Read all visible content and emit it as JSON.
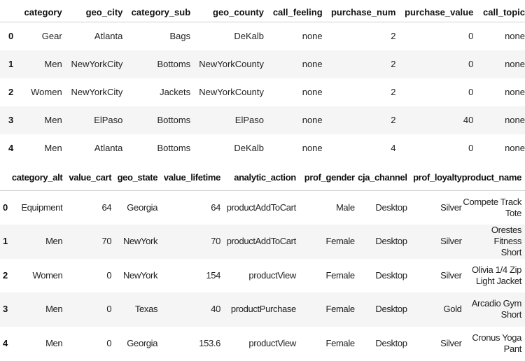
{
  "table1": {
    "columns": [
      "category",
      "geo_city",
      "category_sub",
      "geo_county",
      "call_feeling",
      "purchase_num",
      "purchase_value",
      "call_topic"
    ],
    "rows": [
      {
        "index": "0",
        "cells": [
          "Gear",
          "Atlanta",
          "Bags",
          "DeKalb",
          "none",
          "2",
          "0",
          "none"
        ]
      },
      {
        "index": "1",
        "cells": [
          "Men",
          "NewYorkCity",
          "Bottoms",
          "NewYorkCounty",
          "none",
          "2",
          "0",
          "none"
        ]
      },
      {
        "index": "2",
        "cells": [
          "Women",
          "NewYorkCity",
          "Jackets",
          "NewYorkCounty",
          "none",
          "2",
          "0",
          "none"
        ]
      },
      {
        "index": "3",
        "cells": [
          "Men",
          "ElPaso",
          "Bottoms",
          "ElPaso",
          "none",
          "2",
          "40",
          "none"
        ]
      },
      {
        "index": "4",
        "cells": [
          "Men",
          "Atlanta",
          "Bottoms",
          "DeKalb",
          "none",
          "4",
          "0",
          "none"
        ]
      }
    ]
  },
  "table2": {
    "columns": [
      "category_alt",
      "value_cart",
      "geo_state",
      "value_lifetime",
      "analytic_action",
      "prof_gender",
      "cja_channel",
      "prof_loyalty",
      "product_name"
    ],
    "rows": [
      {
        "index": "0",
        "cells": [
          "Equipment",
          "64",
          "Georgia",
          "64",
          "productAddToCart",
          "Male",
          "Desktop",
          "Silver"
        ],
        "product_name": [
          "Compete Track",
          "Tote"
        ]
      },
      {
        "index": "1",
        "cells": [
          "Men",
          "70",
          "NewYork",
          "70",
          "productAddToCart",
          "Female",
          "Desktop",
          "Silver"
        ],
        "product_name": [
          "Orestes Fitness",
          "Short"
        ]
      },
      {
        "index": "2",
        "cells": [
          "Women",
          "0",
          "NewYork",
          "154",
          "productView",
          "Female",
          "Desktop",
          "Silver"
        ],
        "product_name": [
          "Olivia 1/4 Zip",
          "Light Jacket"
        ]
      },
      {
        "index": "3",
        "cells": [
          "Men",
          "0",
          "Texas",
          "40",
          "productPurchase",
          "Female",
          "Desktop",
          "Gold"
        ],
        "product_name": [
          "Arcadio Gym",
          "Short"
        ]
      },
      {
        "index": "4",
        "cells": [
          "Men",
          "0",
          "Georgia",
          "153.6",
          "productView",
          "Female",
          "Desktop",
          "Silver"
        ],
        "product_name": [
          "Cronus Yoga",
          "Pant"
        ]
      }
    ]
  }
}
